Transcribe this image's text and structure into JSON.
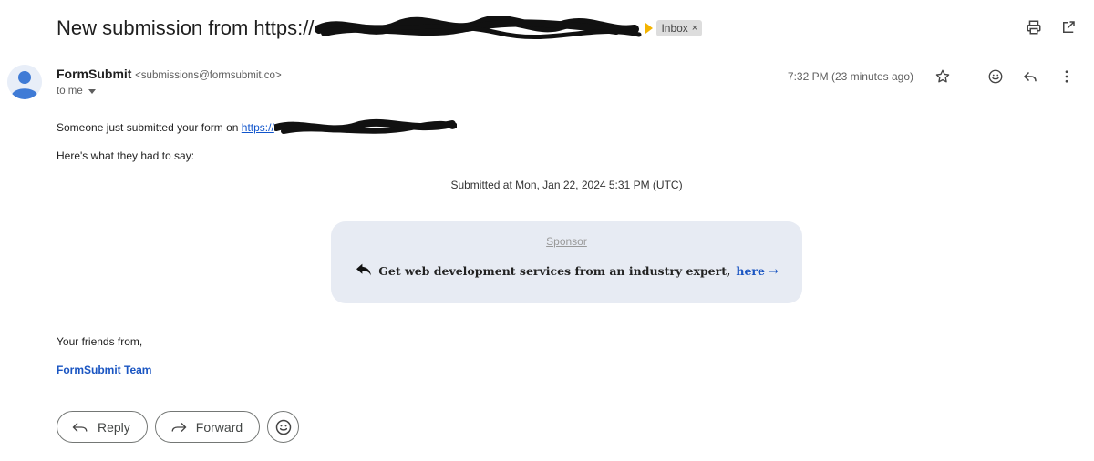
{
  "header": {
    "subject": "New submission from https://",
    "label": "Inbox",
    "label_close": "×"
  },
  "message": {
    "sender_name": "FormSubmit",
    "sender_email": "<submissions@formsubmit.co>",
    "recipient": "to me",
    "time": "7:32 PM (23 minutes ago)"
  },
  "body": {
    "line1_prefix": "Someone just submitted your form on ",
    "line1_link": "https://",
    "line2": "Here's what they had to say:",
    "submitted_at": "Submitted at Mon, Jan 22, 2024 5:31 PM (UTC)",
    "sponsor_label": "Sponsor",
    "sponsor_text": "Get web development services from an industry expert,",
    "sponsor_link": "here →",
    "closing": "Your friends from,",
    "team": "FormSubmit Team"
  },
  "actions": {
    "reply": "Reply",
    "forward": "Forward"
  },
  "colors": {
    "link": "#1155cc",
    "accent": "#1a55c2",
    "sponsor_bg": "#e7ebf3",
    "label_bg": "#dddddd",
    "label_arrow": "#f4b400"
  },
  "icons": [
    "print-icon",
    "open-in-new-window-icon",
    "avatar-icon",
    "star-icon",
    "emoji-icon",
    "reply-icon",
    "more-vert-icon",
    "forward-icon",
    "caret-down-icon"
  ]
}
